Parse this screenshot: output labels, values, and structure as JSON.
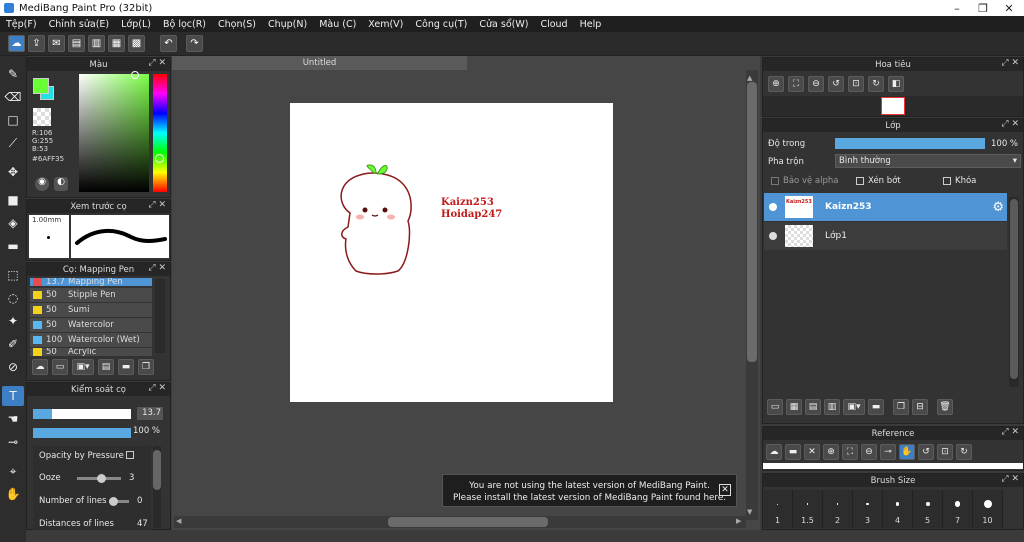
{
  "window": {
    "title": "MediBang Paint Pro (32bit)"
  },
  "menu": [
    "Tệp(F)",
    "Chỉnh sửa(E)",
    "Lớp(L)",
    "Bộ lọc(R)",
    "Chọn(S)",
    "Chụp(N)",
    "Màu (C)",
    "Xem(V)",
    "Công cụ(T)",
    "Cửa sổ(W)",
    "Cloud",
    "Help"
  ],
  "color_panel": {
    "title": "Màu",
    "primary_color": "#6AFF35",
    "secondary_color": "#22E3E3",
    "r": "R:106",
    "g": "G:255",
    "b": "B:53",
    "hex": "#6AFF35"
  },
  "brush_preview": {
    "title": "Xem trước cọ",
    "size": "1.00mm"
  },
  "brush_list": {
    "title": "Cọ: Mapping Pen",
    "items": [
      {
        "size": "13.7",
        "name": "Mapping Pen",
        "color": "#e84d4d"
      },
      {
        "size": "50",
        "name": "Stipple Pen",
        "color": "#f2d21b"
      },
      {
        "size": "50",
        "name": "Sumi",
        "color": "#f2d21b"
      },
      {
        "size": "50",
        "name": "Watercolor",
        "color": "#5ab8f0"
      },
      {
        "size": "100",
        "name": "Watercolor (Wet)",
        "color": "#5ab8f0"
      },
      {
        "size": "50",
        "name": "Acrylic",
        "color": "#f2d21b"
      }
    ]
  },
  "brush_control": {
    "title": "Kiểm soát cọ",
    "size_value": "13.7",
    "size_fraction": 0.19,
    "opacity_value": "100 %",
    "opacity_fraction": 1.0,
    "opacity_by_pressure": "Opacity by Pressure",
    "ooze_label": "Ooze",
    "ooze_value": "3",
    "lines_label": "Number of lines",
    "lines_value": "0",
    "distance_label": "Distances of lines",
    "distance_value": "47"
  },
  "document": {
    "tab": "Untitled",
    "text_line1": "Kaizn253",
    "text_line2": "Hoidap247"
  },
  "notice": {
    "line1": "You are not using the latest version of MediBang Paint.",
    "line2": "Please install the latest version of MediBang Paint found here."
  },
  "navigator": {
    "title": "Hoa tiêu"
  },
  "layer_panel": {
    "title": "Lớp",
    "opacity_label": "Độ trong",
    "opacity_value": "100 %",
    "opacity_fraction": 1.0,
    "blend_label": "Pha trộn",
    "blend_value": "Bình thường",
    "protect_alpha": "Bảo vệ alpha",
    "clipping": "Xén bớt",
    "lock": "Khóa",
    "layers": [
      {
        "name": "Kaizn253",
        "selected": true
      },
      {
        "name": "Lớp1",
        "selected": false
      }
    ]
  },
  "reference": {
    "title": "Reference"
  },
  "brush_size": {
    "title": "Brush Size",
    "sizes": [
      "1",
      "1.5",
      "2",
      "3",
      "4",
      "5",
      "7",
      "10"
    ]
  }
}
